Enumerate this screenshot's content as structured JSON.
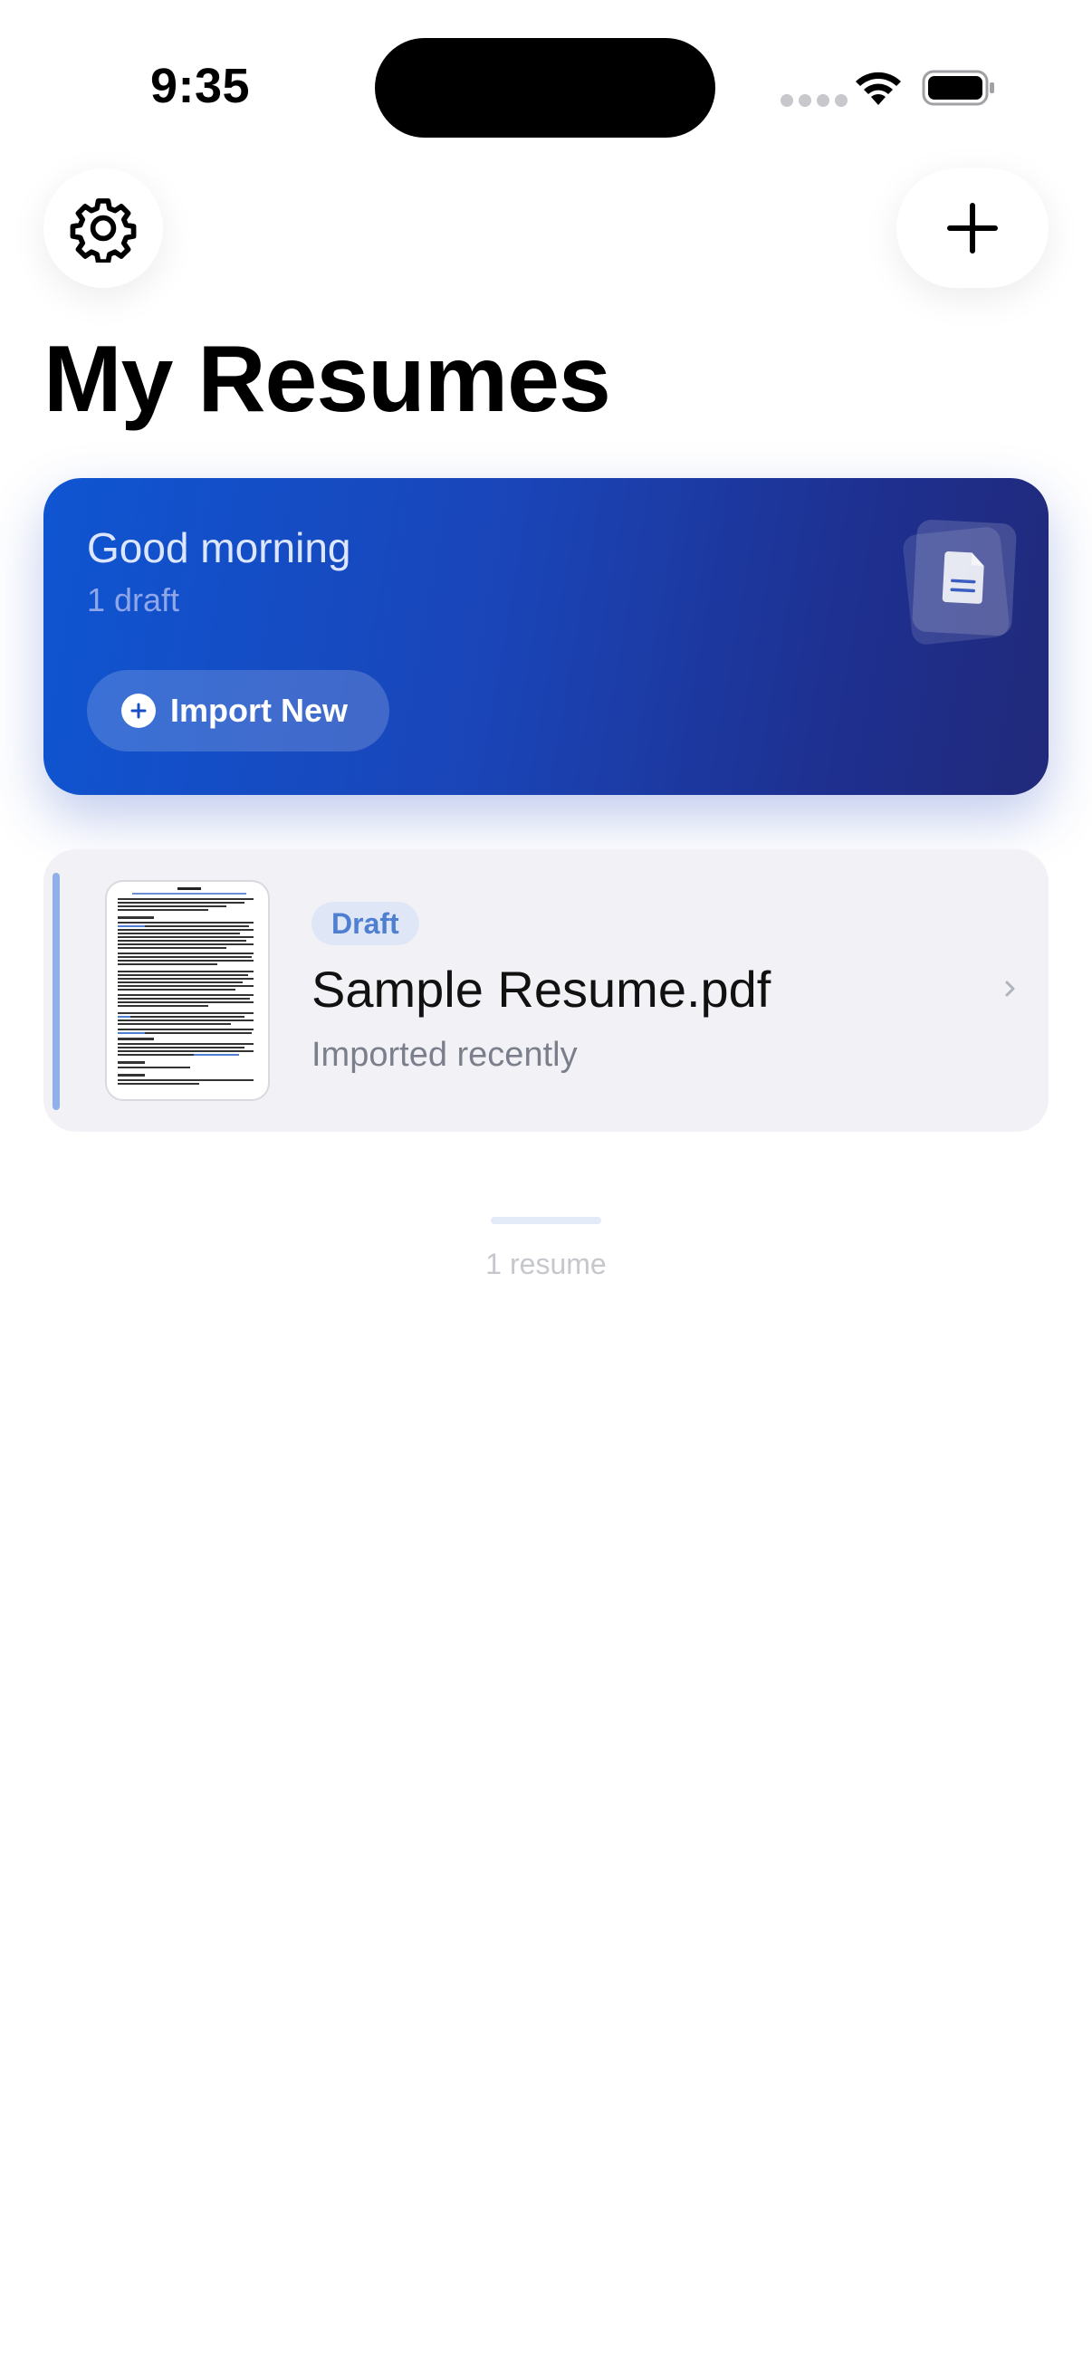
{
  "status_bar": {
    "time": "9:35"
  },
  "header": {
    "settings_icon": "gear-icon",
    "add_icon": "plus-icon",
    "title": "My Resumes"
  },
  "hero": {
    "greeting": "Good morning",
    "subtitle": "1 draft",
    "import_label": "Import New",
    "icon": "document-stack-icon",
    "colors": {
      "gradient_start": "#0f55d2",
      "gradient_end": "#212a7a"
    }
  },
  "resumes": [
    {
      "status": "Draft",
      "name": "Sample Resume.pdf",
      "subtitle": "Imported recently",
      "accent_color": "#8fb0e8"
    }
  ],
  "footer": {
    "count": "1 resume"
  }
}
